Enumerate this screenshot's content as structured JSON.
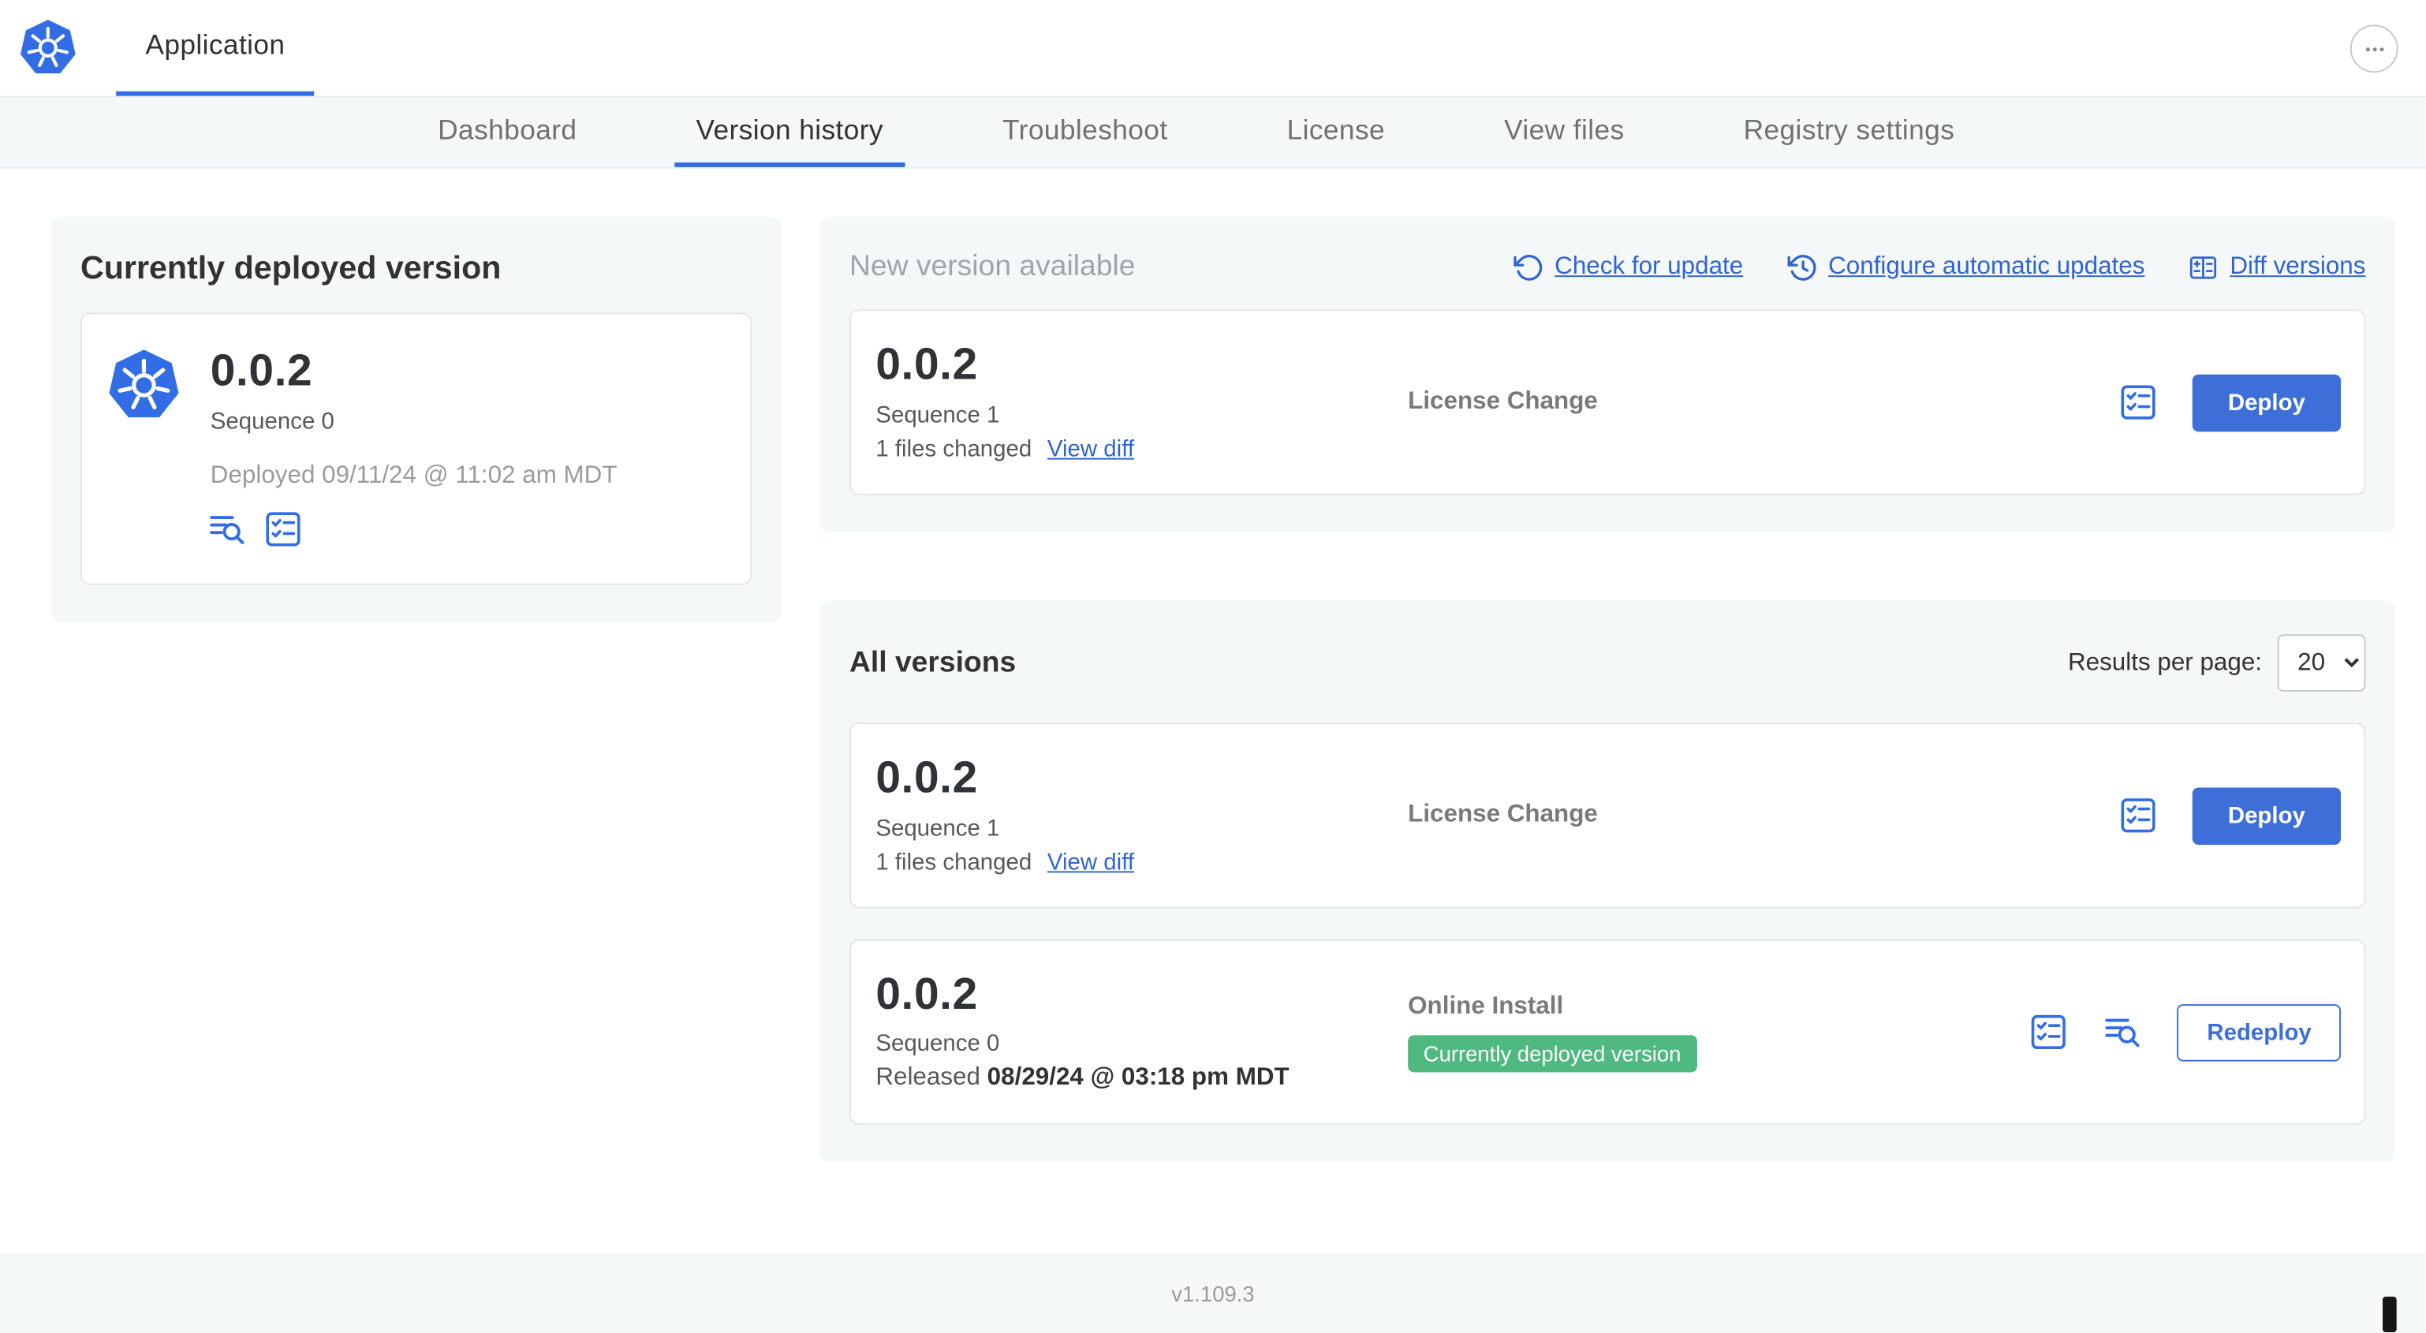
{
  "colors": {
    "accent_blue": "#326de6",
    "link_blue": "#3065cf",
    "button_blue": "#3e6fd9",
    "badge_green": "#4fb97f",
    "panel_gray": "#f5f8f9"
  },
  "header": {
    "app_tab": "Application",
    "more_icon": "ellipsis-icon",
    "logo_icon": "kubernetes-logo"
  },
  "nav": {
    "tabs": [
      {
        "label": "Dashboard",
        "active": false
      },
      {
        "label": "Version history",
        "active": true
      },
      {
        "label": "Troubleshoot",
        "active": false
      },
      {
        "label": "License",
        "active": false
      },
      {
        "label": "View files",
        "active": false
      },
      {
        "label": "Registry settings",
        "active": false
      }
    ]
  },
  "current_version": {
    "heading": "Currently deployed version",
    "version": "0.0.2",
    "sequence": "Sequence 0",
    "deployed": "Deployed 09/11/24 @ 11:02 am MDT",
    "icons": [
      "release-notes-icon",
      "preflight-checks-icon"
    ]
  },
  "new_version": {
    "heading": "New version available",
    "actions": {
      "check_for_update": {
        "label": "Check for update",
        "icon": "refresh-icon"
      },
      "configure_auto_updates": {
        "label": "Configure automatic updates",
        "icon": "schedule-icon"
      },
      "diff_versions": {
        "label": "Diff versions",
        "icon": "diff-icon"
      }
    },
    "row": {
      "version": "0.0.2",
      "sequence": "Sequence 1",
      "files_changed": "1 files changed",
      "view_diff": "View diff",
      "source": "License Change",
      "action_label": "Deploy",
      "icons": [
        "preflight-checks-icon"
      ]
    }
  },
  "all_versions": {
    "heading": "All versions",
    "results_per_page_label": "Results per page:",
    "results_per_page_value": "20",
    "rows": [
      {
        "version": "0.0.2",
        "sequence": "Sequence 1",
        "files_changed": "1 files changed",
        "view_diff": "View diff",
        "source": "License Change",
        "action_label": "Deploy",
        "icons": [
          "preflight-checks-icon"
        ]
      },
      {
        "version": "0.0.2",
        "sequence": "Sequence 0",
        "released_label": "Released",
        "released_date": "08/29/24 @ 03:18 pm MDT",
        "source": "Online Install",
        "badge": "Currently deployed version",
        "action_label": "Redeploy",
        "icons": [
          "preflight-checks-icon",
          "release-notes-icon"
        ]
      }
    ]
  },
  "footer": {
    "app_version": "v1.109.3"
  }
}
